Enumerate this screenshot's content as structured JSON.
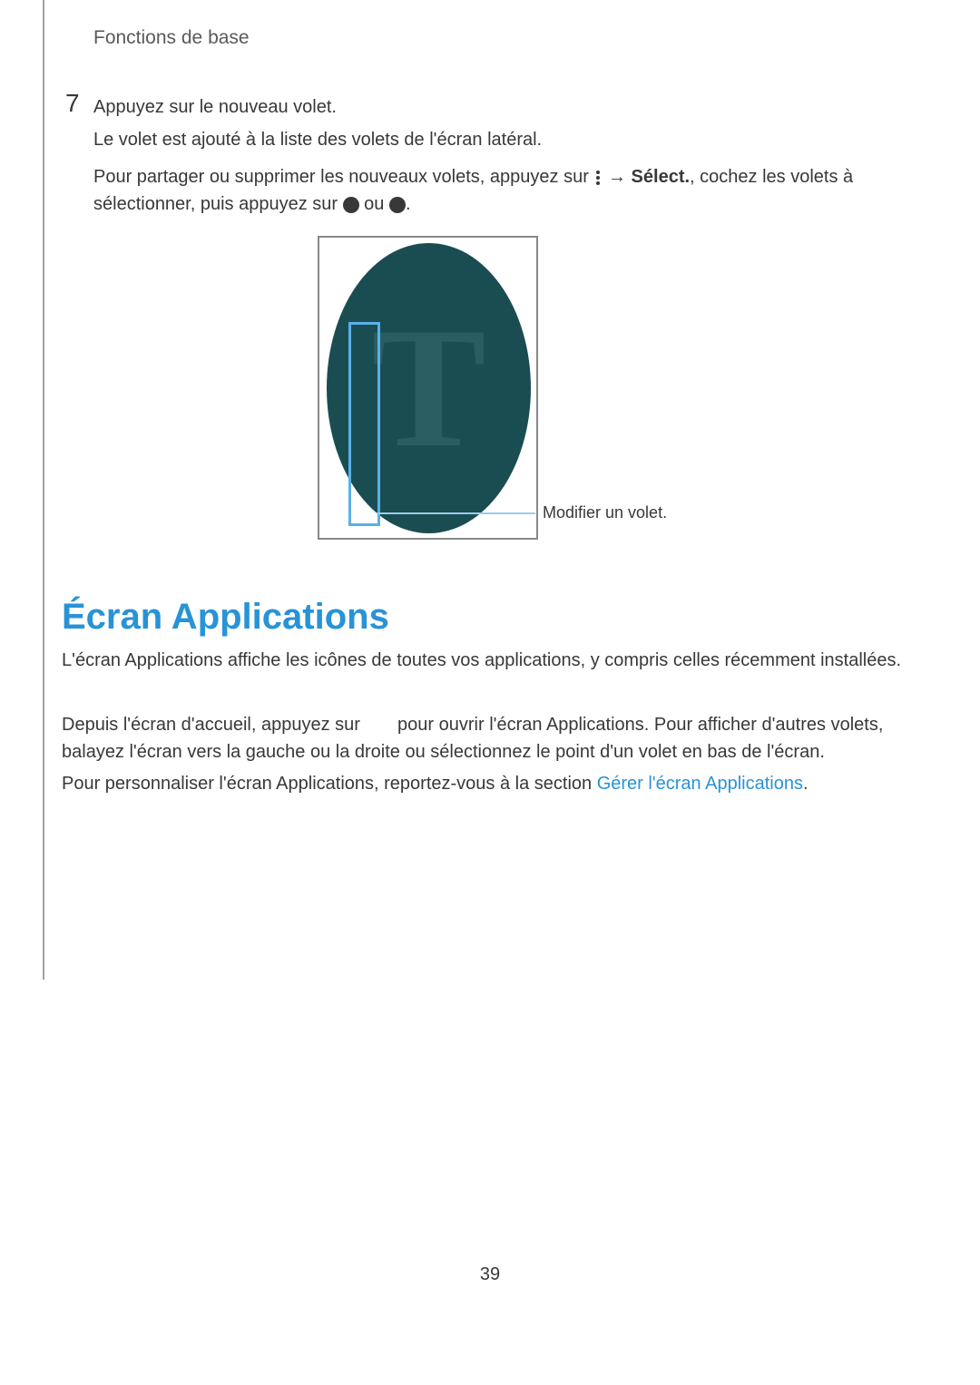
{
  "header": {
    "section": "Fonctions de base"
  },
  "step": {
    "number": "7",
    "line1": "Appuyez sur le nouveau volet.",
    "line2": "Le volet est ajouté à la liste des volets de l'écran latéral.",
    "line3_part1": "Pour partager ou supprimer les nouveaux volets, appuyez sur ",
    "line3_arrow": " → ",
    "line3_select": "Sélect.",
    "line3_part2": ", cochez les volets à sélectionner, puis appuyez sur ",
    "line3_ou": " ou ",
    "line3_end": "."
  },
  "callout": {
    "label": "Modifier un volet."
  },
  "heading": "Écran Applications",
  "body": {
    "p1": "L'écran Applications affiche les icônes de toutes vos applications, y compris celles récemment installées.",
    "p2_part1": "Depuis l'écran d'accueil, appuyez sur ",
    "p2_part2": " pour ouvrir l'écran Applications. Pour afficher d'autres volets, balayez l'écran vers la gauche ou la droite ou sélectionnez le point d'un volet en bas de l'écran.",
    "p3_part1": "Pour personnaliser l'écran Applications, reportez-vous à la section ",
    "p3_link": "Gérer l'écran Applications",
    "p3_end": "."
  },
  "page_number": "39"
}
